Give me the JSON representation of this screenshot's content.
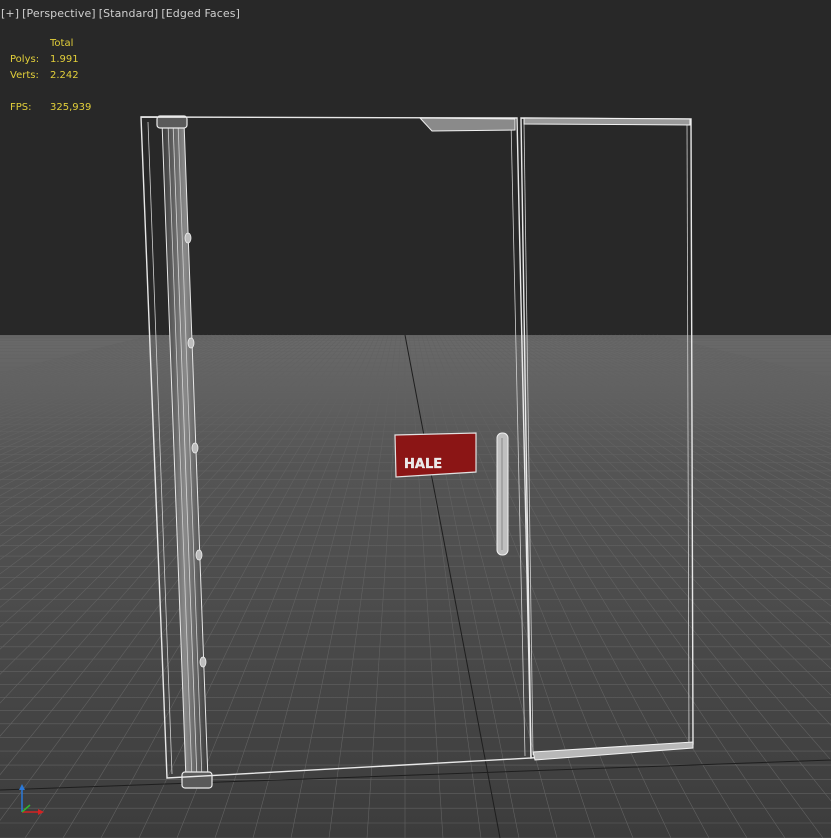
{
  "viewport": {
    "labels": [
      "[+]",
      "[Perspective]",
      "[Standard]",
      "[Edged Faces]"
    ]
  },
  "stats": {
    "header": "Total",
    "polys_label": "Polys:",
    "polys_value": "1.991",
    "verts_label": "Verts:",
    "verts_value": "2.242",
    "fps_label": "FPS:",
    "fps_value": "325,939"
  },
  "scene": {
    "sign_text": "HALE",
    "colors": {
      "background": "#282828",
      "ground": "#4a4a4a",
      "grid_line": "#5c5c5c",
      "wireframe": "#e8e8e8",
      "sign": "#8b1515",
      "stats_text": "#e2cf3a"
    }
  },
  "gizmo": {
    "axes": [
      "x",
      "y",
      "z"
    ]
  }
}
